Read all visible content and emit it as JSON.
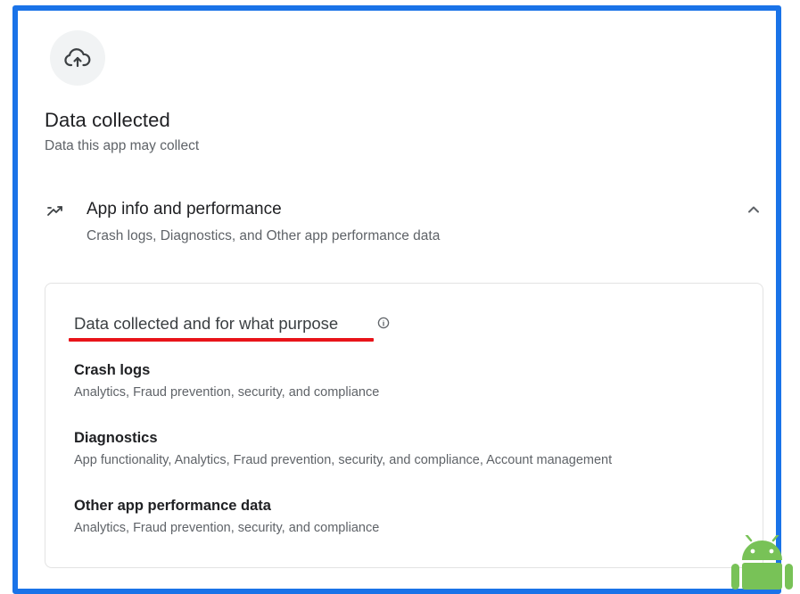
{
  "header": {
    "icon": "cloud-upload-icon",
    "title": "Data collected",
    "subtitle": "Data this app may collect"
  },
  "section": {
    "icon": "trending-icon",
    "title": "App info and performance",
    "subtitle": "Crash logs, Diagnostics, and Other app performance data",
    "expand_icon": "chevron-up-icon"
  },
  "card": {
    "heading": "Data collected and for what purpose",
    "info_icon": "info-icon",
    "items": [
      {
        "title": "Crash logs",
        "purposes": "Analytics, Fraud prevention, security, and compliance"
      },
      {
        "title": "Diagnostics",
        "purposes": "App functionality, Analytics, Fraud prevention, security, and compliance, Account management"
      },
      {
        "title": "Other app performance data",
        "purposes": "Analytics, Fraud prevention, security, and compliance"
      }
    ]
  },
  "colors": {
    "frame_border": "#1a73e8",
    "highlight_underline": "#e8141a",
    "android_green": "#78c257"
  }
}
